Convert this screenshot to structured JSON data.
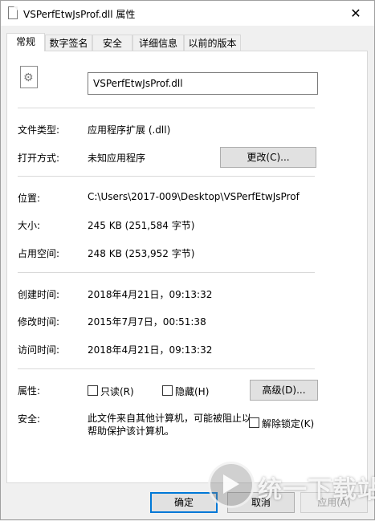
{
  "window": {
    "title": "VSPerfEtwJsProf.dll 属性",
    "close_glyph": "✕"
  },
  "tabs": [
    {
      "label": "常规",
      "active": true
    },
    {
      "label": "数字签名",
      "active": false
    },
    {
      "label": "安全",
      "active": false
    },
    {
      "label": "详细信息",
      "active": false
    },
    {
      "label": "以前的版本",
      "active": false
    }
  ],
  "general": {
    "file_name": "VSPerfEtwJsProf.dll",
    "file_type_label": "文件类型:",
    "file_type_value": "应用程序扩展 (.dll)",
    "opens_with_label": "打开方式:",
    "opens_with_value": "未知应用程序",
    "change_button": "更改(C)...",
    "location_label": "位置:",
    "location_value": "C:\\Users\\2017-009\\Desktop\\VSPerfEtwJsProf",
    "size_label": "大小:",
    "size_value": "245 KB (251,584 字节)",
    "size_on_disk_label": "占用空间:",
    "size_on_disk_value": "248 KB (253,952 字节)",
    "created_label": "创建时间:",
    "created_value": "2018年4月21日，09:13:32",
    "modified_label": "修改时间:",
    "modified_value": "2015年7月7日，00:51:38",
    "accessed_label": "访问时间:",
    "accessed_value": "2018年4月21日，09:13:32",
    "attributes_label": "属性:",
    "readonly_label": "只读(R)",
    "hidden_label": "隐藏(H)",
    "advanced_button": "高级(D)...",
    "security_label": "安全:",
    "security_text": "此文件来自其他计算机，可能被阻止以帮助保护该计算机。",
    "unblock_label": "解除锁定(K)"
  },
  "footer": {
    "ok": "确定",
    "cancel": "取消",
    "apply": "应用(A)"
  },
  "watermark": {
    "text": "统一下载站"
  }
}
